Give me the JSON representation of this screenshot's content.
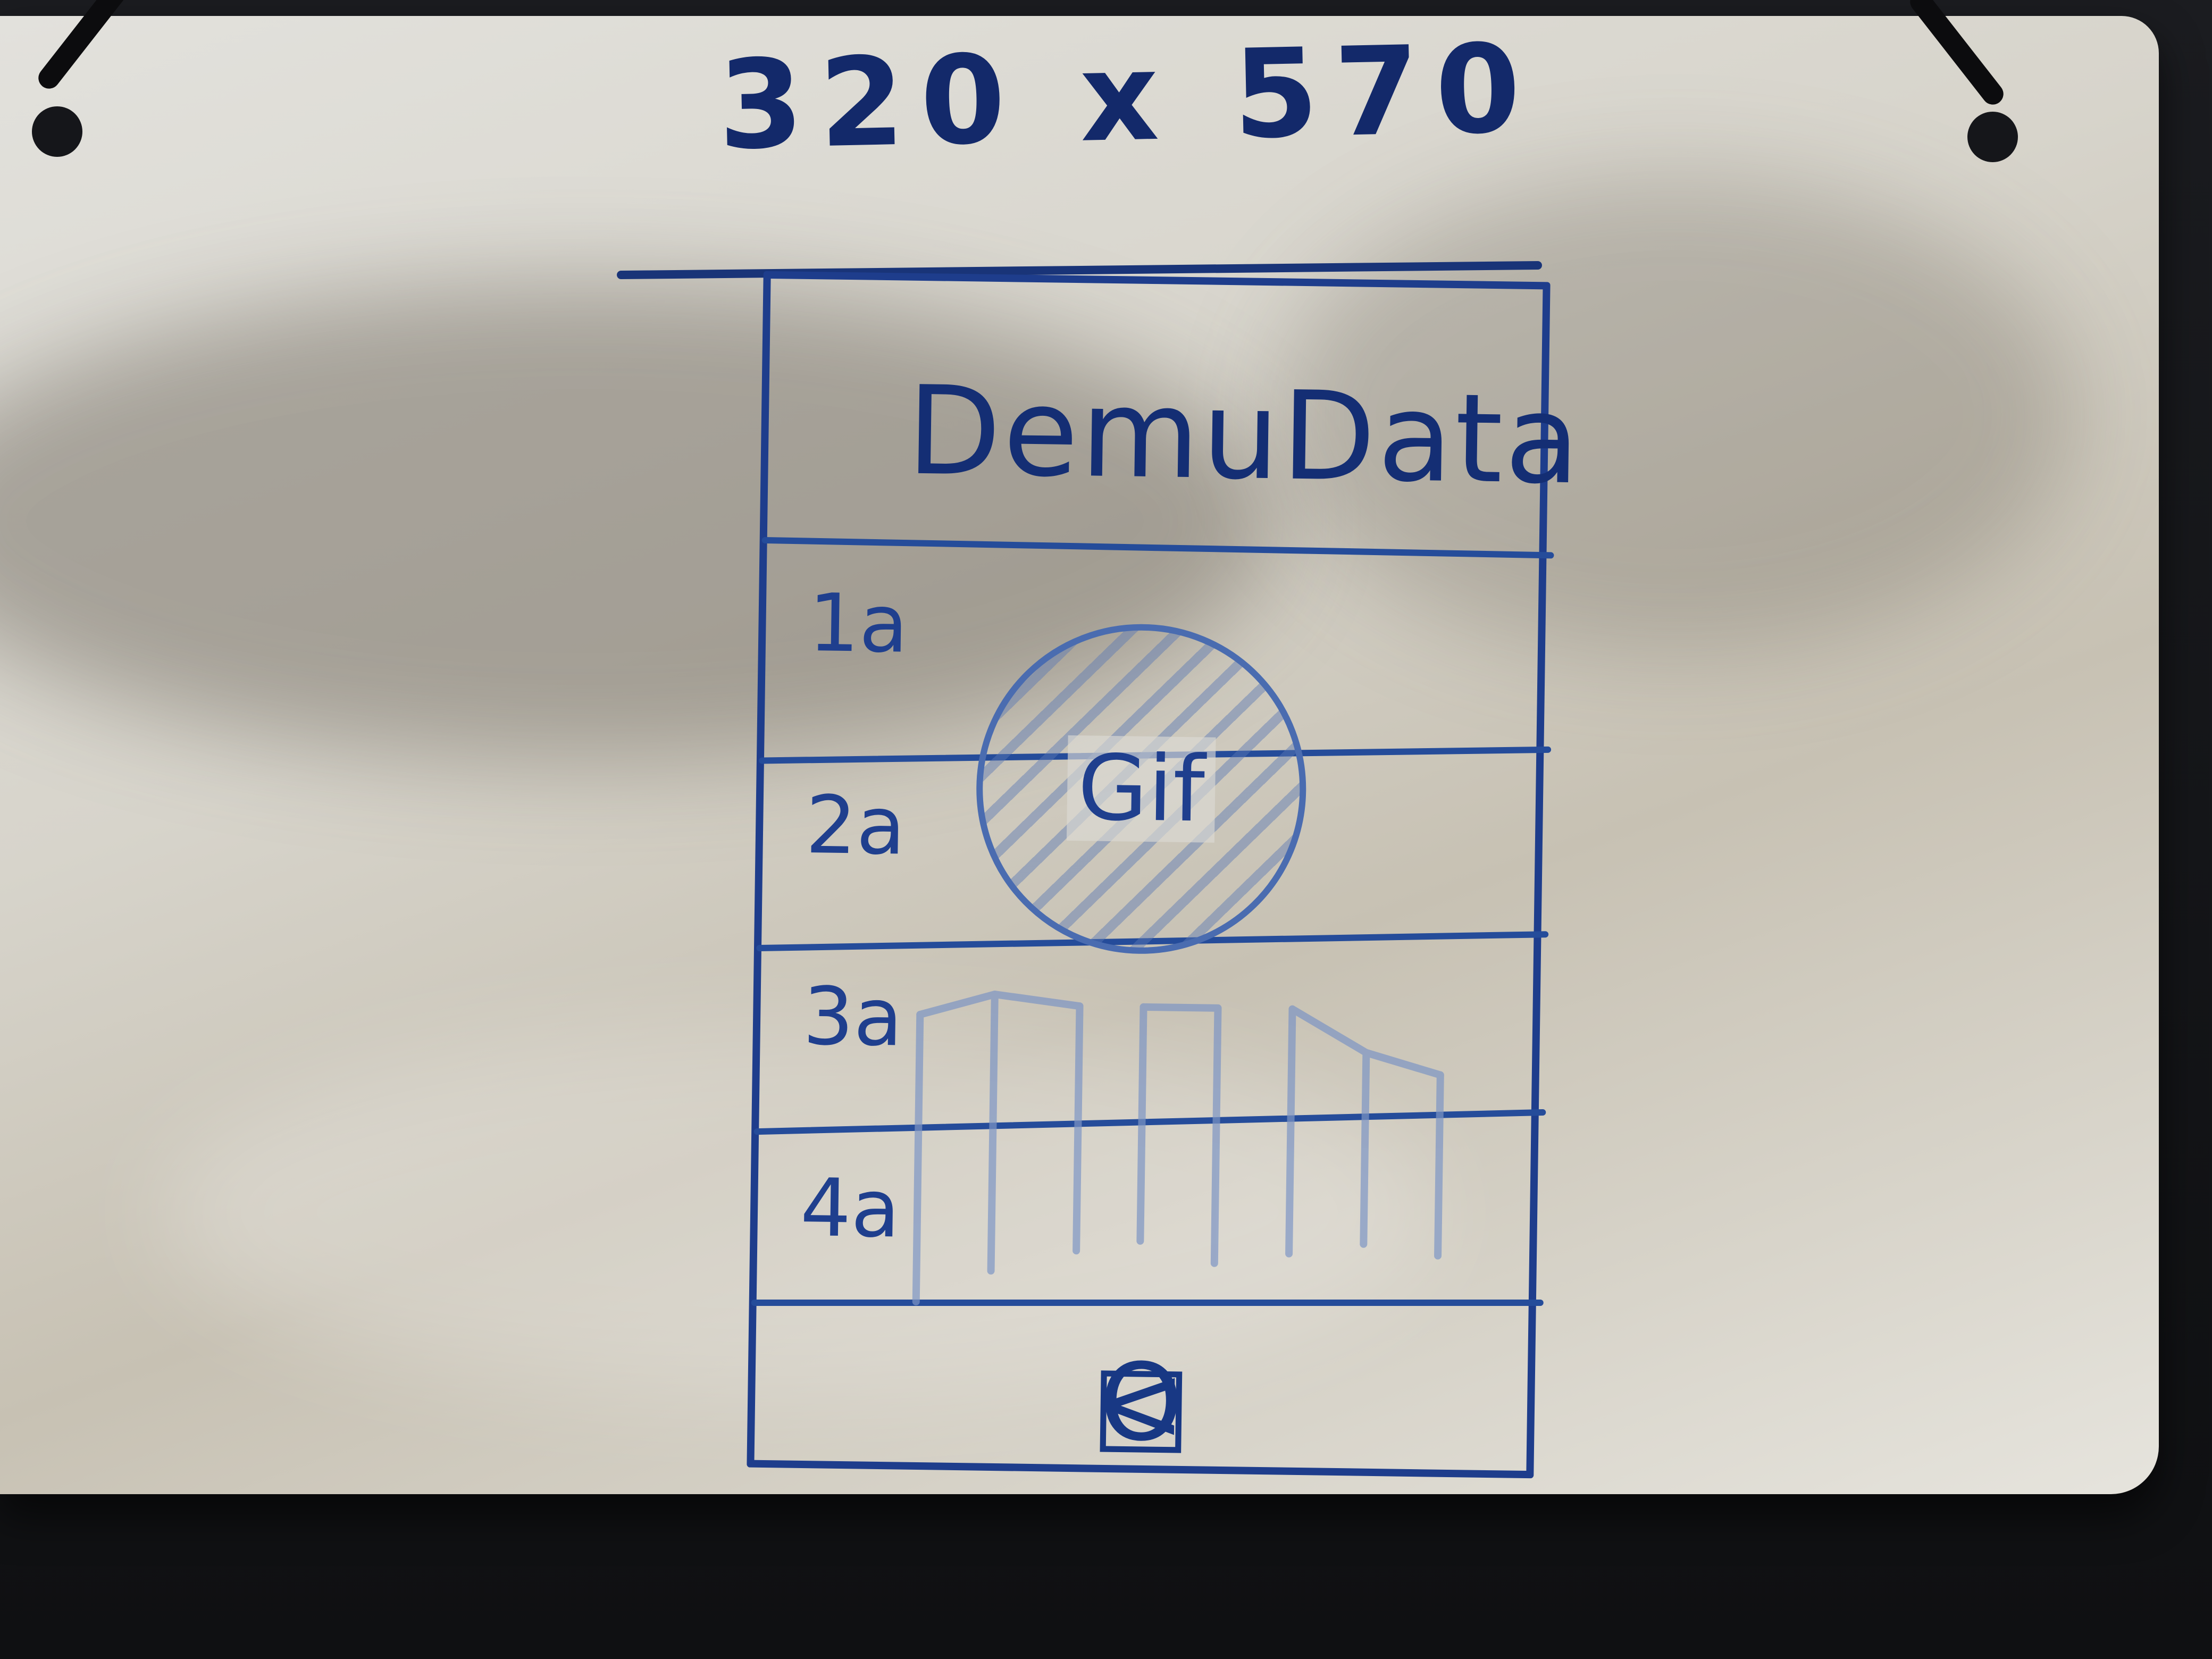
{
  "board": {
    "heading": "320 x 570"
  },
  "app": {
    "title": "DemuData",
    "rows": [
      {
        "label": "1a"
      },
      {
        "label": "2a"
      },
      {
        "label": "3a"
      },
      {
        "label": "4a"
      }
    ],
    "gif": {
      "label": "Gif"
    },
    "nav": {
      "back": "<",
      "home": "O",
      "recent": "□"
    }
  },
  "colors": {
    "ink": "#1d3b86",
    "board": "#dcdad3"
  }
}
